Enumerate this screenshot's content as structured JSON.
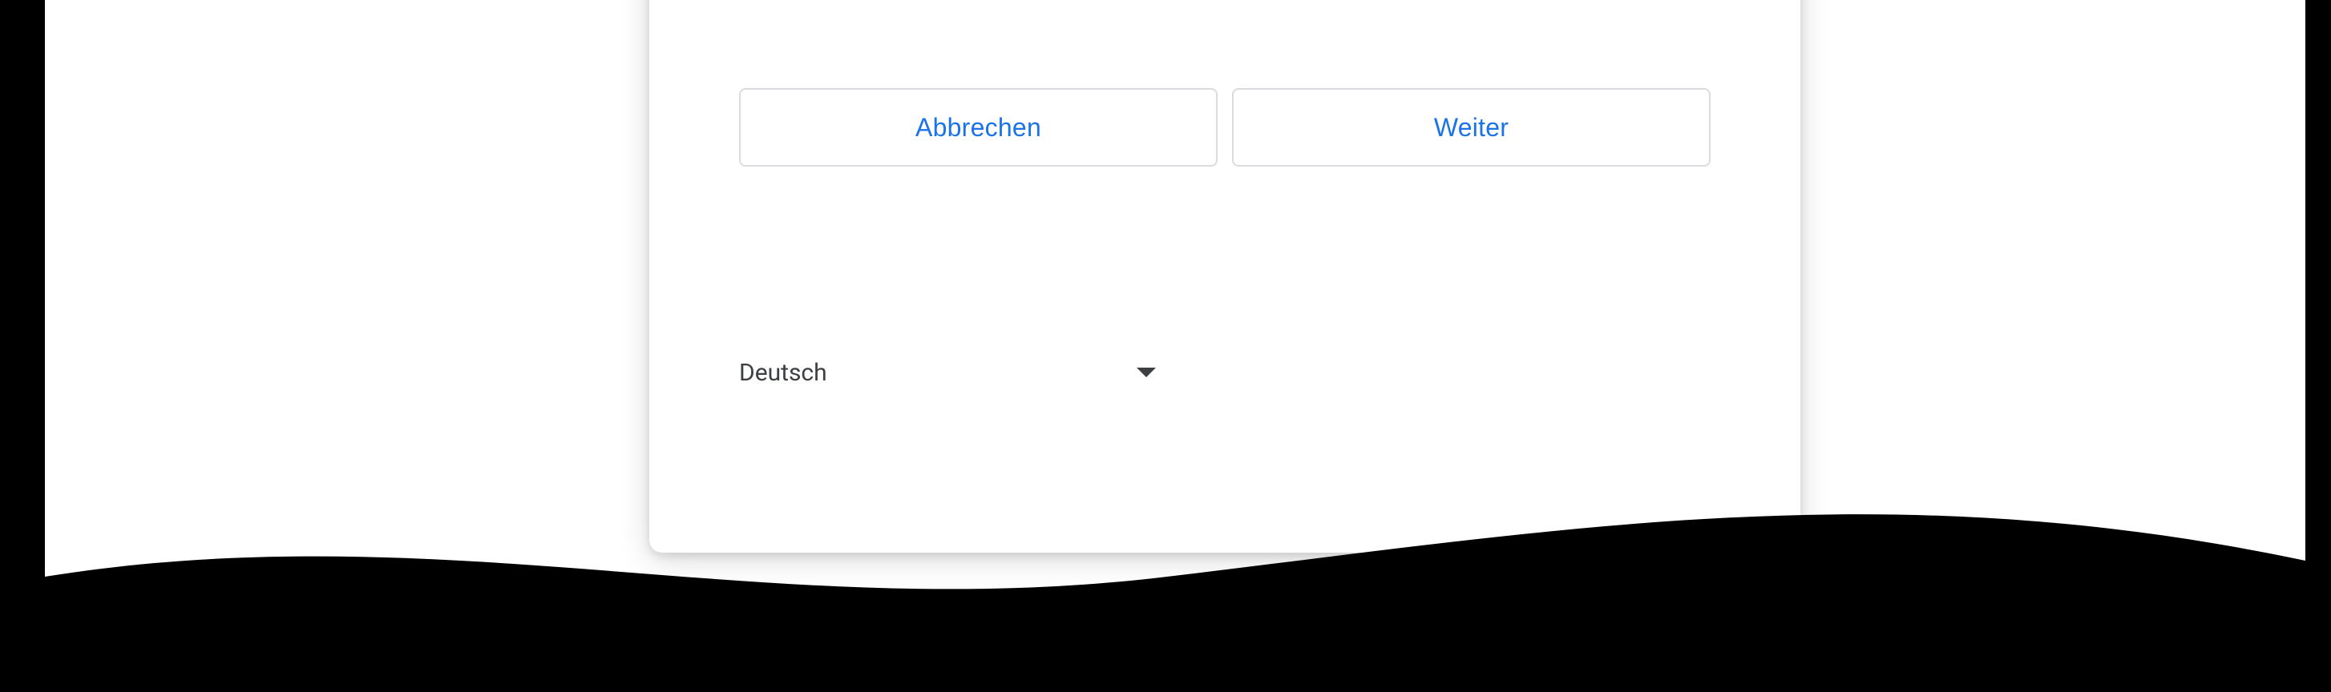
{
  "dialog": {
    "cancel_label": "Abbrechen",
    "continue_label": "Weiter"
  },
  "language": {
    "selected": "Deutsch"
  }
}
